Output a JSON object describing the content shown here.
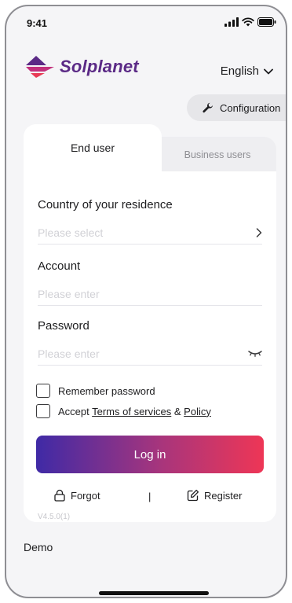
{
  "status_bar": {
    "time": "9:41"
  },
  "header": {
    "brand_name": "Solplanet",
    "language_label": "English",
    "config_label": "Configuration"
  },
  "tabs": [
    {
      "label": "End user",
      "active": true
    },
    {
      "label": "Business users",
      "active": false
    }
  ],
  "form": {
    "country": {
      "label": "Country of your residence",
      "placeholder": "Please select"
    },
    "account": {
      "label": "Account",
      "placeholder": "Please enter"
    },
    "password": {
      "label": "Password",
      "placeholder": "Please enter"
    },
    "remember_label": "Remember password",
    "accept_prefix": "Accept ",
    "terms_label": "Terms of services",
    "accept_and": " & ",
    "policy_label": "Policy",
    "login_label": "Log in",
    "forgot_label": "Forgot",
    "separator": "|",
    "register_label": "Register",
    "version": "V4.5.0(1)"
  },
  "demo_label": "Demo",
  "colors": {
    "brand_purple": "#5b2a86",
    "gradient_start": "#3f2aa6",
    "gradient_end": "#ee3656"
  }
}
